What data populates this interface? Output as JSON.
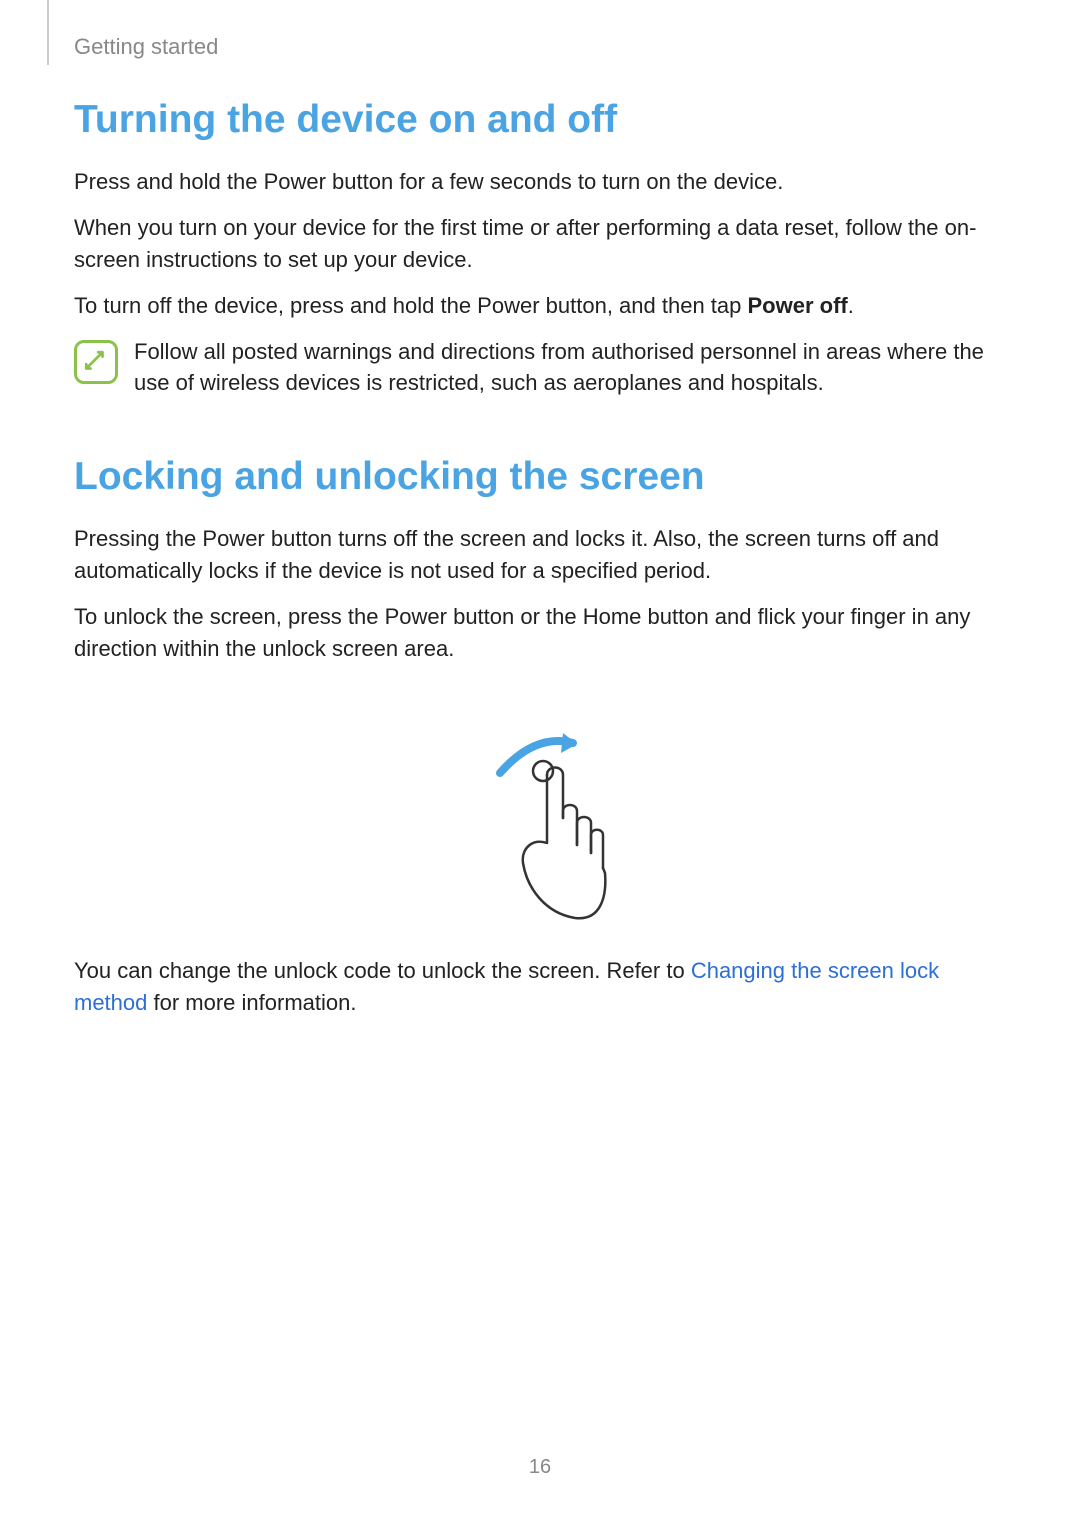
{
  "header": {
    "section_title": "Getting started"
  },
  "section1": {
    "heading": "Turning the device on and off",
    "p1": "Press and hold the Power button for a few seconds to turn on the device.",
    "p2": "When you turn on your device for the first time or after performing a data reset, follow the on-screen instructions to set up your device.",
    "p3_pre": "To turn off the device, press and hold the Power button, and then tap ",
    "p3_bold": "Power off",
    "p3_post": ".",
    "note": "Follow all posted warnings and directions from authorised personnel in areas where the use of wireless devices is restricted, such as aeroplanes and hospitals."
  },
  "section2": {
    "heading": "Locking and unlocking the screen",
    "p1": "Pressing the Power button turns off the screen and locks it. Also, the screen turns off and automatically locks if the device is not used for a specified period.",
    "p2": "To unlock the screen, press the Power button or the Home button and flick your finger in any direction within the unlock screen area.",
    "p3_pre": "You can change the unlock code to unlock the screen. Refer to ",
    "p3_link": "Changing the screen lock method",
    "p3_post": " for more information."
  },
  "page_number": "16"
}
